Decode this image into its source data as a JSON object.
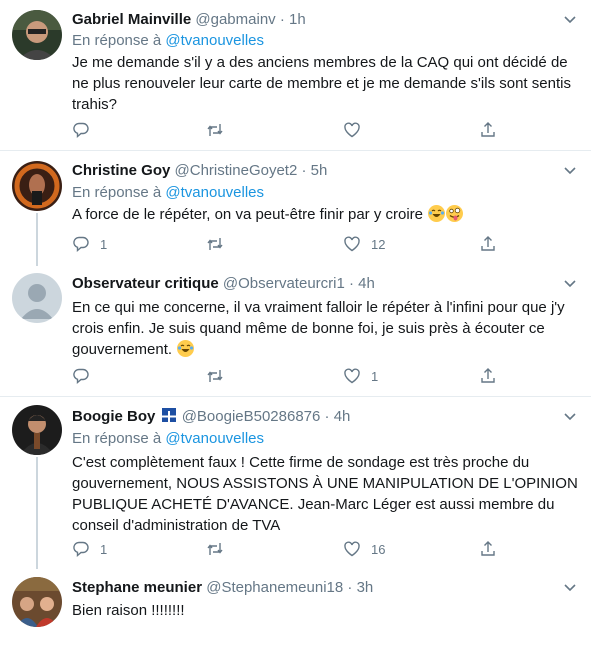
{
  "tweets": [
    {
      "name": "Gabriel Mainville",
      "handle": "@gabmainv",
      "time": "1h",
      "reply_prefix": "En réponse à",
      "reply_mention": "@tvanouvelles",
      "text": "Je me demande s'il y a des anciens membres de la CAQ qui ont décidé de ne plus renouveler leur carte de membre et je me demande s'ils sont sentis trahis?",
      "replies": "",
      "retweets": "",
      "likes": ""
    },
    {
      "name": "Christine Goy",
      "handle": "@ChristineGoyet2",
      "time": "5h",
      "reply_prefix": "En réponse à",
      "reply_mention": "@tvanouvelles",
      "text": "A force de le répéter, on va peut-être finir par y croire",
      "replies": "1",
      "retweets": "",
      "likes": "12"
    },
    {
      "name": "Observateur critique",
      "handle": "@Observateurcri1",
      "time": "4h",
      "text": "En ce qui me concerne, il va vraiment falloir le répéter à l'infini pour que j'y crois enfin. Je suis quand même de bonne foi, je suis près à écouter ce gouvernement.",
      "replies": "",
      "retweets": "",
      "likes": "1"
    },
    {
      "name": "Boogie Boy",
      "handle": "@BoogieB50286876",
      "time": "4h",
      "reply_prefix": "En réponse à",
      "reply_mention": "@tvanouvelles",
      "text": "C'est complètement faux ! Cette firme de sondage est très proche du gouvernement, NOUS ASSISTONS À UNE MANIPULATION DE L'OPINION PUBLIQUE ACHETÉ D'AVANCE. Jean-Marc Léger est aussi membre du conseil d'administration de TVA",
      "replies": "1",
      "retweets": "",
      "likes": "16"
    },
    {
      "name": "Stephane meunier",
      "handle": "@Stephanemeuni18",
      "time": "3h",
      "text": "Bien raison !!!!!!!!",
      "replies": "",
      "retweets": "",
      "likes": ""
    }
  ],
  "separator": "·",
  "colors": {
    "text": "#14171a",
    "secondary": "#657786",
    "link": "#1b95e0",
    "border": "#e6ecf0"
  },
  "icons": [
    "reply-icon",
    "retweet-icon",
    "like-icon",
    "share-icon",
    "chevron-down-icon"
  ]
}
